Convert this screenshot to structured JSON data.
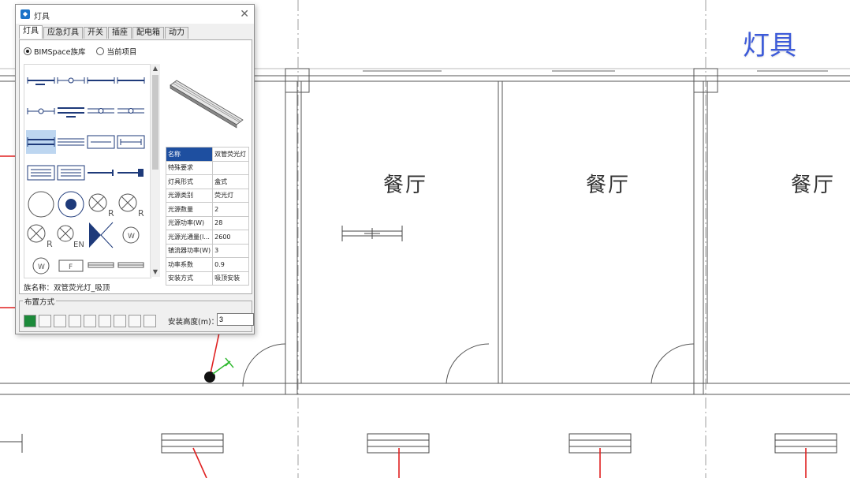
{
  "overlay_title": "灯具",
  "rooms": [
    "餐厅",
    "餐厅",
    "餐厅"
  ],
  "dialog": {
    "title": "灯具",
    "tabs": [
      "灯具",
      "应急灯具",
      "开关",
      "插座",
      "配电箱",
      "动力"
    ],
    "active_tab": 0,
    "radio_options": [
      "BIMSpace族库",
      "当前项目"
    ],
    "selected_radio": 0,
    "symbol_text": {
      "r": "R",
      "en": "EN",
      "w": "W",
      "f": "F"
    },
    "properties": [
      {
        "key": "名称",
        "value": "双管荧光灯"
      },
      {
        "key": "特殊要求",
        "value": ""
      },
      {
        "key": "灯具形式",
        "value": "盒式"
      },
      {
        "key": "光源类别",
        "value": "荧光灯"
      },
      {
        "key": "光源数量",
        "value": "2"
      },
      {
        "key": "光源功率(W)",
        "value": "28"
      },
      {
        "key": "光源光通量(l...",
        "value": "2600"
      },
      {
        "key": "镇流器功率(W)",
        "value": "3"
      },
      {
        "key": "功率系数",
        "value": "0.9"
      },
      {
        "key": "安装方式",
        "value": "吸顶安装"
      }
    ],
    "family_name": "族名称：双管荧光灯_吸顶",
    "layout_group_label": "布置方式",
    "install_height_label": "安装高度(m)：",
    "install_height_value": "3"
  },
  "colors": {
    "accent_blue": "#3d5bd9",
    "wire_red": "#e02020",
    "selection_blue": "#bdd6f0",
    "header_blue": "#1e4fa0"
  }
}
